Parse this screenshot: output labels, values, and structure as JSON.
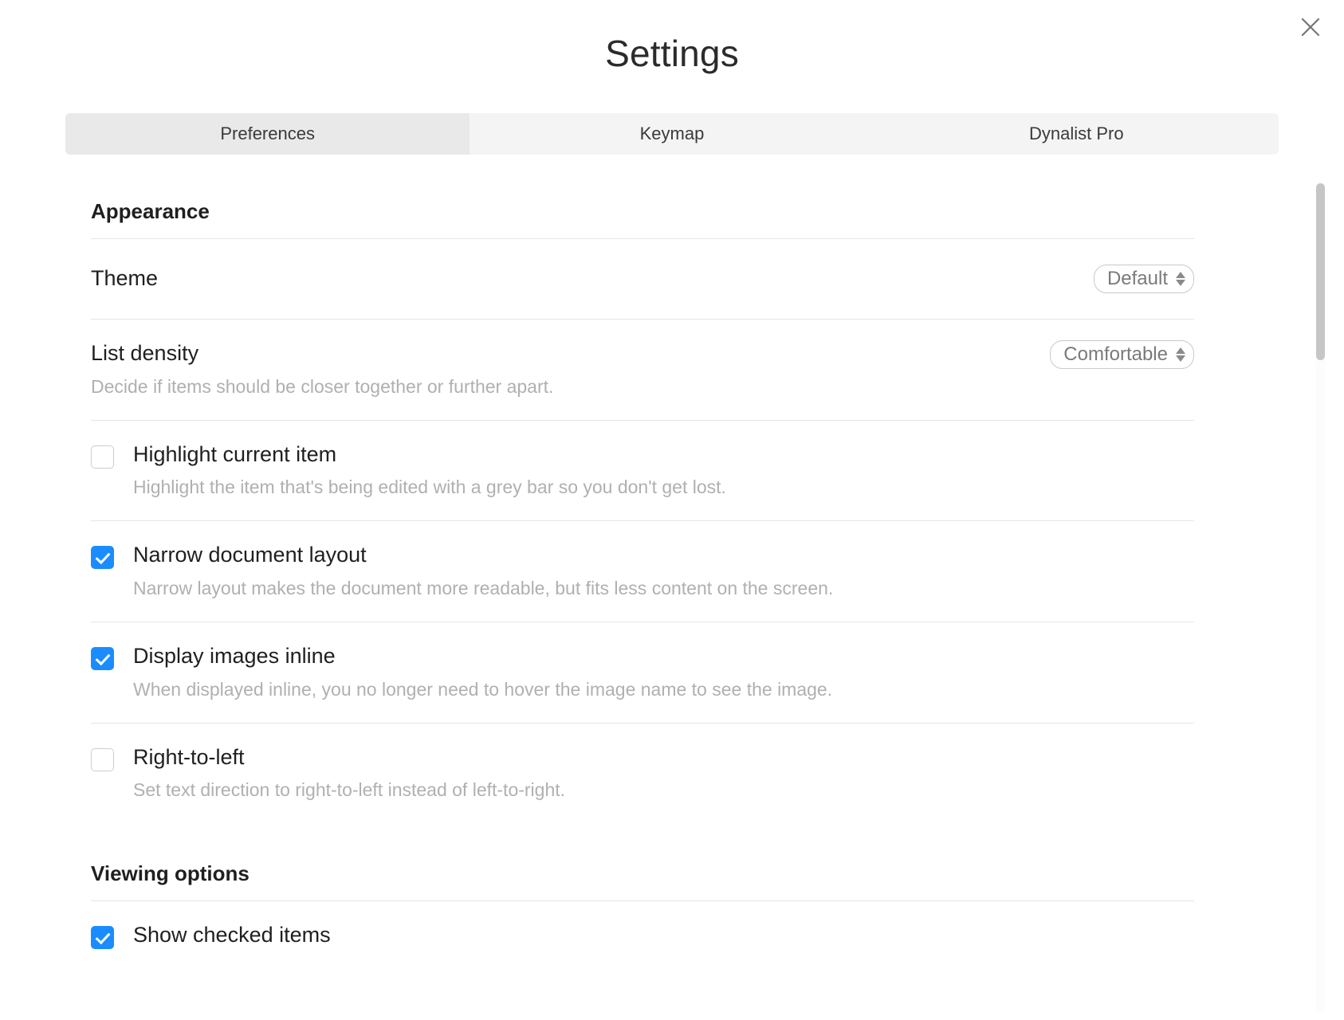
{
  "window": {
    "title": "Settings",
    "close_icon": "close-icon"
  },
  "tabs": [
    {
      "label": "Preferences",
      "active": true
    },
    {
      "label": "Keymap",
      "active": false
    },
    {
      "label": "Dynalist Pro",
      "active": false
    }
  ],
  "sections": [
    {
      "title": "Appearance",
      "rows": [
        {
          "type": "select",
          "label": "Theme",
          "description": "",
          "value": "Default"
        },
        {
          "type": "select",
          "label": "List density",
          "description": "Decide if items should be closer together or further apart.",
          "value": "Comfortable"
        },
        {
          "type": "checkbox",
          "label": "Highlight current item",
          "description": "Highlight the item that's being edited with a grey bar so you don't get lost.",
          "checked": false
        },
        {
          "type": "checkbox",
          "label": "Narrow document layout",
          "description": "Narrow layout makes the document more readable, but fits less content on the screen.",
          "checked": true
        },
        {
          "type": "checkbox",
          "label": "Display images inline",
          "description": "When displayed inline, you no longer need to hover the image name to see the image.",
          "checked": true
        },
        {
          "type": "checkbox",
          "label": "Right-to-left",
          "description": "Set text direction to right-to-left instead of left-to-right.",
          "checked": false
        }
      ]
    },
    {
      "title": "Viewing options",
      "rows": [
        {
          "type": "checkbox",
          "label": "Show checked items",
          "description": "",
          "checked": true
        }
      ]
    }
  ],
  "colors": {
    "accent": "#1a8cff",
    "label": "#1f1f1f",
    "description": "#b0b0b0",
    "divider": "#e6e6e6",
    "tab_bar": "#f4f4f4",
    "tab_active": "#e9e9e9",
    "scrollbar_thumb": "#c6c6c6"
  }
}
